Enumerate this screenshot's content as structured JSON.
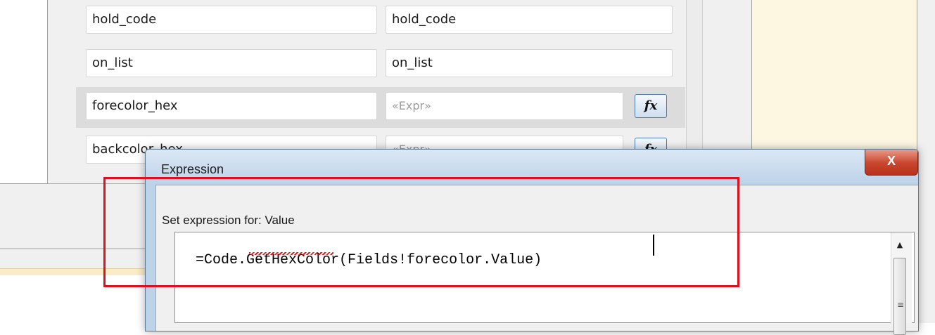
{
  "grid": {
    "rows": [
      {
        "name": "hold_code",
        "value": "hold_code",
        "has_fx": false
      },
      {
        "name": "on_list",
        "value": "on_list",
        "has_fx": false
      },
      {
        "name": "forecolor_hex",
        "value": "«Expr»",
        "has_fx": true
      },
      {
        "name": "backcolor_hex",
        "value": "«Expr»",
        "has_fx": true
      }
    ],
    "fx_label": "fx"
  },
  "dialog": {
    "title": "Expression",
    "close_label": "X",
    "prompt": "Set expression for: Value",
    "expression": "=Code.GetHexColor(Fields!forecolor.Value)"
  },
  "colors": {
    "highlight": "#e0101a",
    "right_panel": "#fdf7e2"
  }
}
